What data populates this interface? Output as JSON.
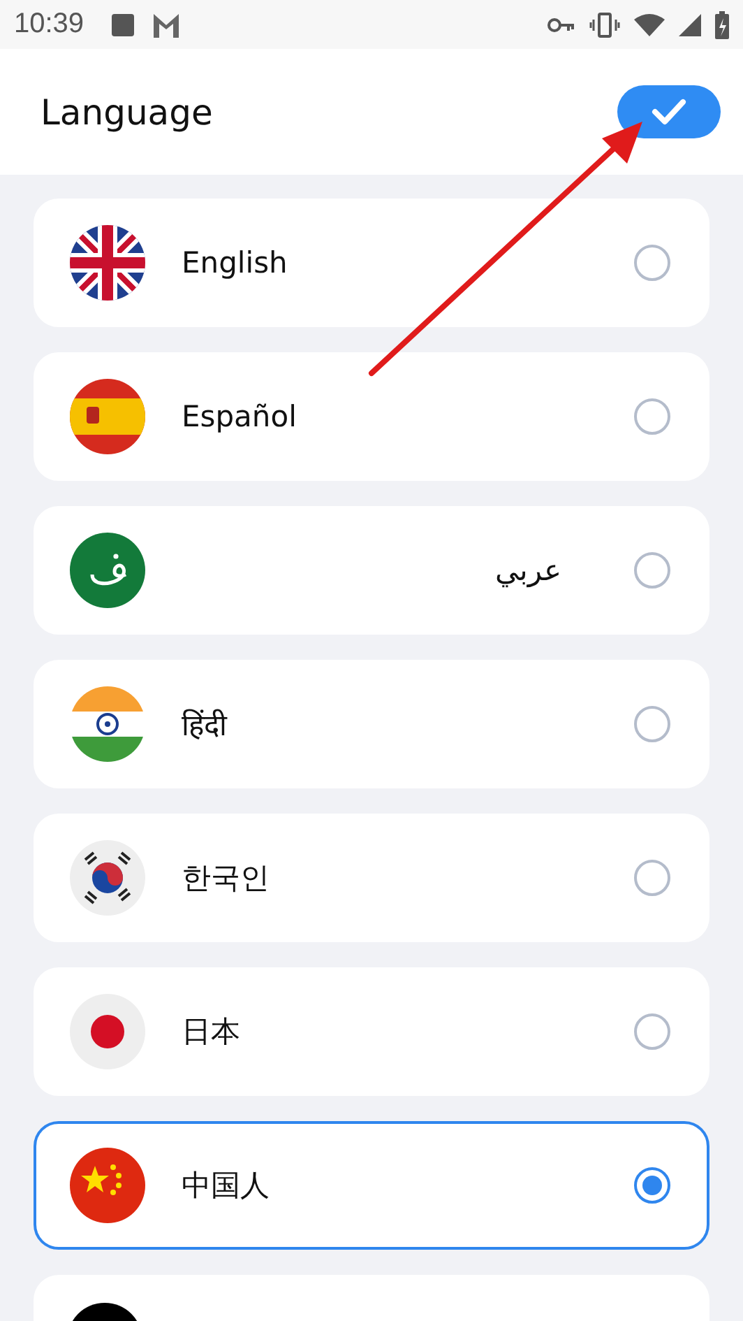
{
  "status_bar": {
    "time": "10:39"
  },
  "header": {
    "title": "Language"
  },
  "languages": [
    {
      "label": "English",
      "rtl": false,
      "selected": false
    },
    {
      "label": "Español",
      "rtl": false,
      "selected": false
    },
    {
      "label": "عربي",
      "rtl": true,
      "selected": false
    },
    {
      "label": "हिंदी",
      "rtl": false,
      "selected": false
    },
    {
      "label": "한국인",
      "rtl": false,
      "selected": false
    },
    {
      "label": "日本",
      "rtl": false,
      "selected": false
    },
    {
      "label": "中国人",
      "rtl": false,
      "selected": true
    }
  ]
}
